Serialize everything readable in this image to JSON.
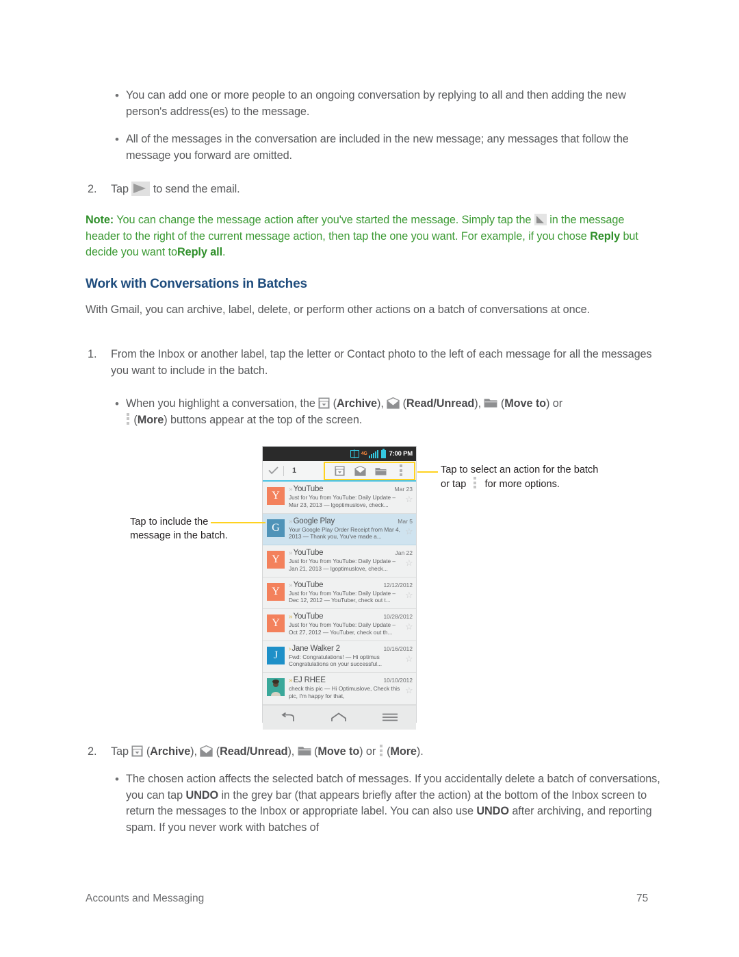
{
  "doc": {
    "bullets_top": [
      "You can add one or more people to an ongoing conversation by replying to all and then adding the new person's address(es) to the message.",
      "All of the messages in the conversation are included in the new message; any messages that follow the message you forward are omitted."
    ],
    "step2_top": {
      "num": "2.",
      "pre": "Tap",
      "post": "to send the email."
    },
    "note": {
      "label": "Note:",
      "part1": "You can change the message action after you've started the message. Simply tap the",
      "part2": "in the message header to the right of the current message action, then tap the one you want. For example, if you chose",
      "bold1": "Reply",
      "part3": "but decide you want to",
      "bold2": "Reply all",
      "part4": "."
    },
    "heading": "Work with Conversations in Batches",
    "intro": "With Gmail, you can archive, label, delete, or perform other actions on a batch of conversations at once.",
    "step1": {
      "num": "1.",
      "text": "From the Inbox or another label, tap the letter or Contact photo to the left of each message for all the messages you want to include in the batch."
    },
    "bullet_icons": {
      "pre": "When you highlight a conversation, the",
      "archive": "Archive",
      "readunread": "Read/Unread",
      "moveto": "Move to",
      "or": "or",
      "more": "More",
      "post": "buttons appear at the top of the screen."
    },
    "step2_bottom": {
      "num": "2.",
      "pre": "Tap",
      "archive": "Archive",
      "readunread": "Read/Unread",
      "moveto": "Move to",
      "or": "or",
      "more": "More",
      "end": "."
    },
    "bullet_bottom": {
      "p1": "The chosen action affects the selected batch of messages. If you accidentally delete a batch of conversations, you can tap",
      "undo1": "UNDO",
      "p2": "in the grey bar (that appears briefly after the action) at the bottom of the Inbox screen to return the messages to the Inbox or appropriate label. You can also use",
      "undo2": "UNDO",
      "p3": "after archiving, and reporting spam. If you never work with batches of"
    },
    "footer": {
      "left": "Accounts and Messaging",
      "page": "75"
    }
  },
  "callouts": {
    "left": {
      "line1": "Tap to include the",
      "line2": "message in the batch."
    },
    "right": {
      "line1": "Tap to select an action for the batch",
      "line2_pre": "or tap",
      "line2_post": "for more options."
    }
  },
  "phone": {
    "statusbar": {
      "time": "7:00 PM",
      "network": "4G",
      "sim_icon": "sim-card-icon",
      "signal_icon": "signal-bars-icon",
      "battery_icon": "battery-icon"
    },
    "actionbar": {
      "check_icon": "checkmark-icon",
      "count": "1",
      "actions": [
        {
          "name": "archive-button",
          "icon": "archive-icon"
        },
        {
          "name": "read-unread-button",
          "icon": "envelope-icon"
        },
        {
          "name": "move-to-button",
          "icon": "folder-icon"
        },
        {
          "name": "more-button",
          "icon": "more-vertical-icon"
        }
      ]
    },
    "messages": [
      {
        "avatar": "Y",
        "avatar_color": "#f3815c",
        "sender": "YouTube",
        "count": "",
        "date": "Mar 23",
        "snippet": "Just for You from YouTube: Daily Update – Mar 23, 2013 — lgoptimuslove, check...",
        "selected": false,
        "chevron": "grey"
      },
      {
        "avatar": "G",
        "avatar_color": "#4f93b8",
        "sender": "Google Play",
        "count": "",
        "date": "Mar 5",
        "snippet": "Your Google Play Order Receipt from Mar 4, 2013 — Thank you, You've made a...",
        "selected": true,
        "chevron": "grey"
      },
      {
        "avatar": "Y",
        "avatar_color": "#f3815c",
        "sender": "YouTube",
        "count": "",
        "date": "Jan 22",
        "snippet": "Just for You from YouTube: Daily Update – Jan 21, 2013 — lgoptimuslove, check...",
        "selected": false,
        "chevron": "grey"
      },
      {
        "avatar": "Y",
        "avatar_color": "#f3815c",
        "sender": "YouTube",
        "count": "",
        "date": "12/12/2012",
        "snippet": "Just for You from YouTube: Daily Update – Dec 12, 2012 — YouTuber, check out t...",
        "selected": false,
        "chevron": "grey"
      },
      {
        "avatar": "Y",
        "avatar_color": "#f3815c",
        "sender": "YouTube",
        "count": "",
        "date": "10/28/2012",
        "snippet": "Just for You from YouTube: Daily Update – Oct 27, 2012 — YouTuber, check out th...",
        "selected": false,
        "chevron": "gold"
      },
      {
        "avatar": "J",
        "avatar_color": "#1e90c8",
        "sender": "Jane Walker",
        "count": "2",
        "date": "10/16/2012",
        "snippet": "Fwd: Congratulations! — Hi optimus Congratulations on your successful...",
        "selected": false,
        "chevron": "gold"
      },
      {
        "avatar": "",
        "avatar_color": "#3aa89a",
        "sender": "EJ RHEE",
        "count": "",
        "date": "10/10/2012",
        "snippet": "check this pic — Hi Optimuslove, Check this pic, I'm happy for that,",
        "selected": false,
        "chevron": "gold"
      }
    ],
    "navbar": [
      {
        "name": "back-button",
        "icon": "back-arrow-icon"
      },
      {
        "name": "home-button",
        "icon": "home-icon"
      },
      {
        "name": "menu-button",
        "icon": "menu-icon"
      }
    ]
  },
  "colors": {
    "note_green": "#3c9a34",
    "heading_blue": "#1d4b7c",
    "highlight_yellow": "#ffd21f",
    "accent_cyan": "#49c3e4"
  }
}
